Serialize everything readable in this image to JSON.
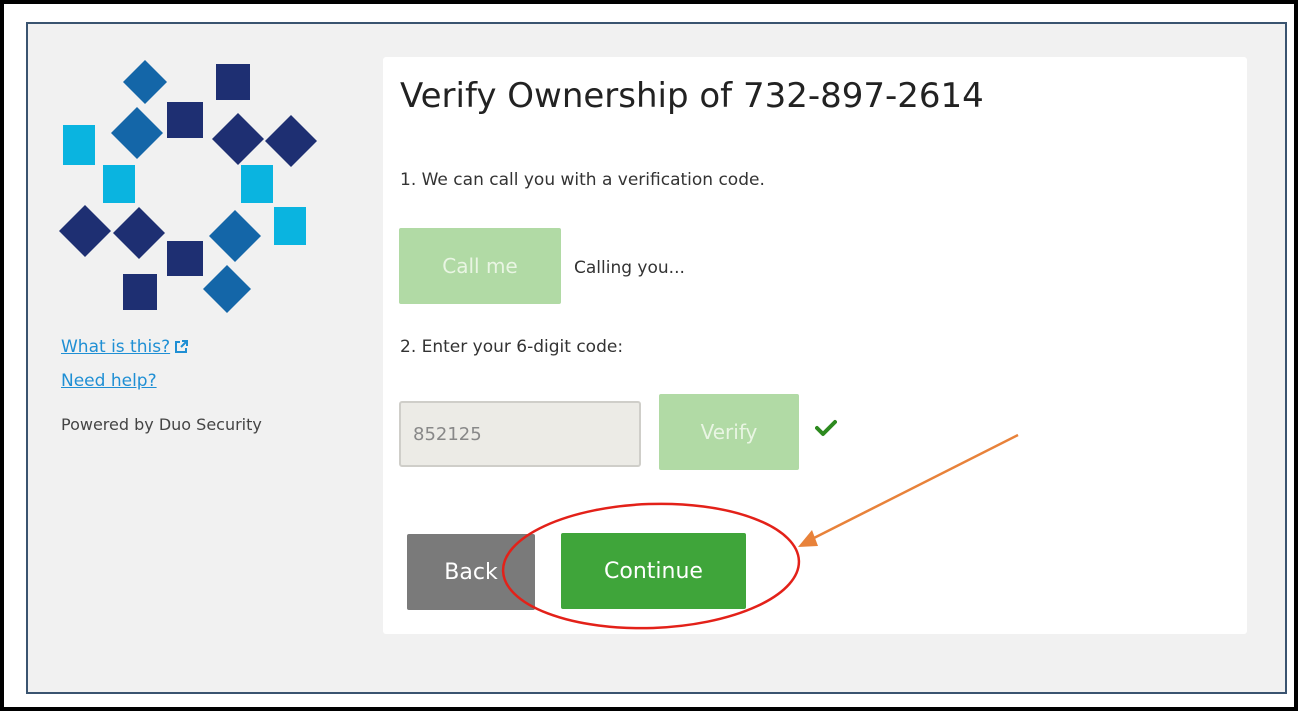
{
  "colors": {
    "frame_border": "#3a5470",
    "panel_background": "#f1f1f1",
    "link": "#1f8fd4",
    "disabled_green": "#b1daa5",
    "primary_green": "#3fa53a",
    "secondary_gray": "#7a7a7a",
    "checkmark": "#2d8a1f",
    "annotation_ellipse": "#e32119",
    "annotation_arrow": "#e8823a"
  },
  "logo": {
    "icon": "duo-security-logo-icon",
    "colors": [
      "#1466a8",
      "#1e2f72",
      "#0ab4e0"
    ]
  },
  "sidebar": {
    "what_is_this": "What is this?",
    "external_icon": "external-link-icon",
    "need_help": "Need help?",
    "powered_by": "Powered by Duo Security"
  },
  "main": {
    "title": "Verify Ownership of 732-897-2614",
    "step1": "1. We can call you with a verification code.",
    "call_button": "Call me",
    "calling_status": "Calling you...",
    "step2": "2. Enter your 6-digit code:",
    "code_value": "852125",
    "verify_button": "Verify",
    "verified_icon": "checkmark-icon",
    "back_button": "Back",
    "continue_button": "Continue"
  },
  "annotations": {
    "ellipse": "red-ellipse-highlight",
    "arrow": "orange-arrow-pointer"
  }
}
